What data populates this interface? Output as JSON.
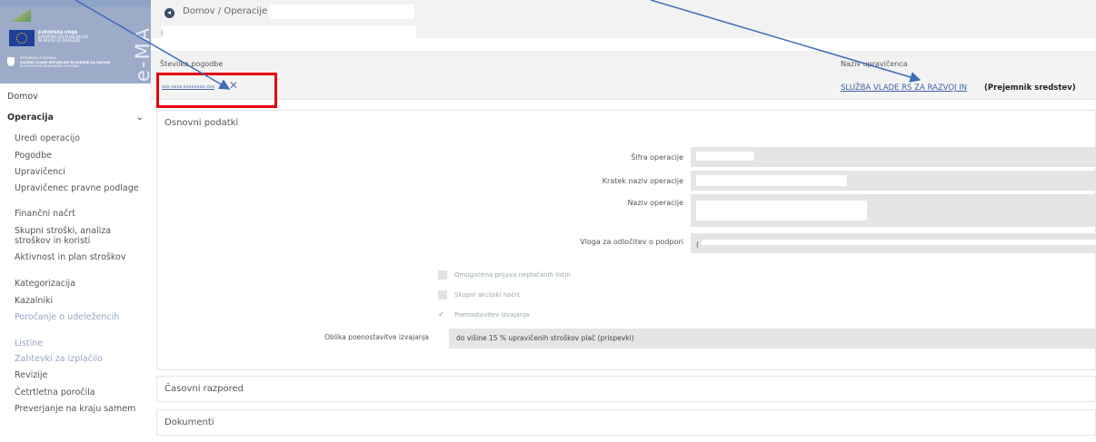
{
  "sidebar": {
    "app_name": "e-MA",
    "eu_logo_lines": [
      "EVROPSKA UNIJA",
      "EVROPSKI SOCIALNI SKLAD",
      "IN SKLAD ZA KOHEZIJO"
    ],
    "gov_logo_lines": [
      "REPUBLIKA SLOVENIJA",
      "SLUŽBA VLADE REPUBLIKE SLOVENIJE ZA RAZVOJ",
      "IN EVROPSKO KOHEZIJSKO POLITIKO"
    ],
    "home": "Domov",
    "operations": "Operacija",
    "items": [
      {
        "label": "Uredi operacijo"
      },
      {
        "label": "Pogodbe"
      },
      {
        "label": "Upravičenci"
      },
      {
        "label": "Upravičenec pravne podlage"
      },
      {
        "label": "Finančni načrt"
      },
      {
        "label": "Skupni stroški, analiza stroškov in koristi"
      },
      {
        "label": "Aktivnost in plan stroškov"
      },
      {
        "label": "Kategorizacija"
      },
      {
        "label": "Kazalniki"
      },
      {
        "label": "Poročanje o udeležencih"
      },
      {
        "label": "Listine"
      },
      {
        "label": "Zahtevki za izplačilo"
      },
      {
        "label": "Revizije"
      },
      {
        "label": "Četrtletna poročila"
      },
      {
        "label": "Preverjanje na kraju samem"
      }
    ]
  },
  "breadcrumb": "Domov / Operacije /",
  "subtitle_mark": "i",
  "header": {
    "contract_label": "Številka pogodbe",
    "beneficiary_label": "Naziv upravičenca",
    "contract_value": "xxx.xxxx.xxxxxxxx.xxx",
    "beneficiary_value": "SLUŽBA VLADE RS ZA RAZVOJ IN",
    "beneficiary_role": "(Prejemnik sredstev)",
    "remove_symbol": "✕"
  },
  "sections": {
    "basic": "Osnovni podatki",
    "schedule": "Časovni razpored",
    "documents": "Dokumenti"
  },
  "fields": {
    "sifra": "Šifra operacije",
    "kratek": "Kratek naziv operacije",
    "naziv": "Naziv operacije",
    "vloga": "Vloga za odločitev o podpori",
    "vloga_value": "("
  },
  "checks": {
    "neplacanih": "Omogočena prijava neplačanih listin",
    "akcijski": "Skupni akcijski načrt",
    "poenostavitev": "Poenostavitev izvajanja",
    "tick": "✓"
  },
  "oblika": {
    "label": "Oblika poenostavitve izvajanja",
    "value": "do višine 15 % upravičenih stroškov plač (prispevki)"
  },
  "colors": {
    "brand": "#9cabc8",
    "link": "#3f5fa5",
    "highlight": "#e3000b",
    "arrow": "#3f6db8"
  }
}
